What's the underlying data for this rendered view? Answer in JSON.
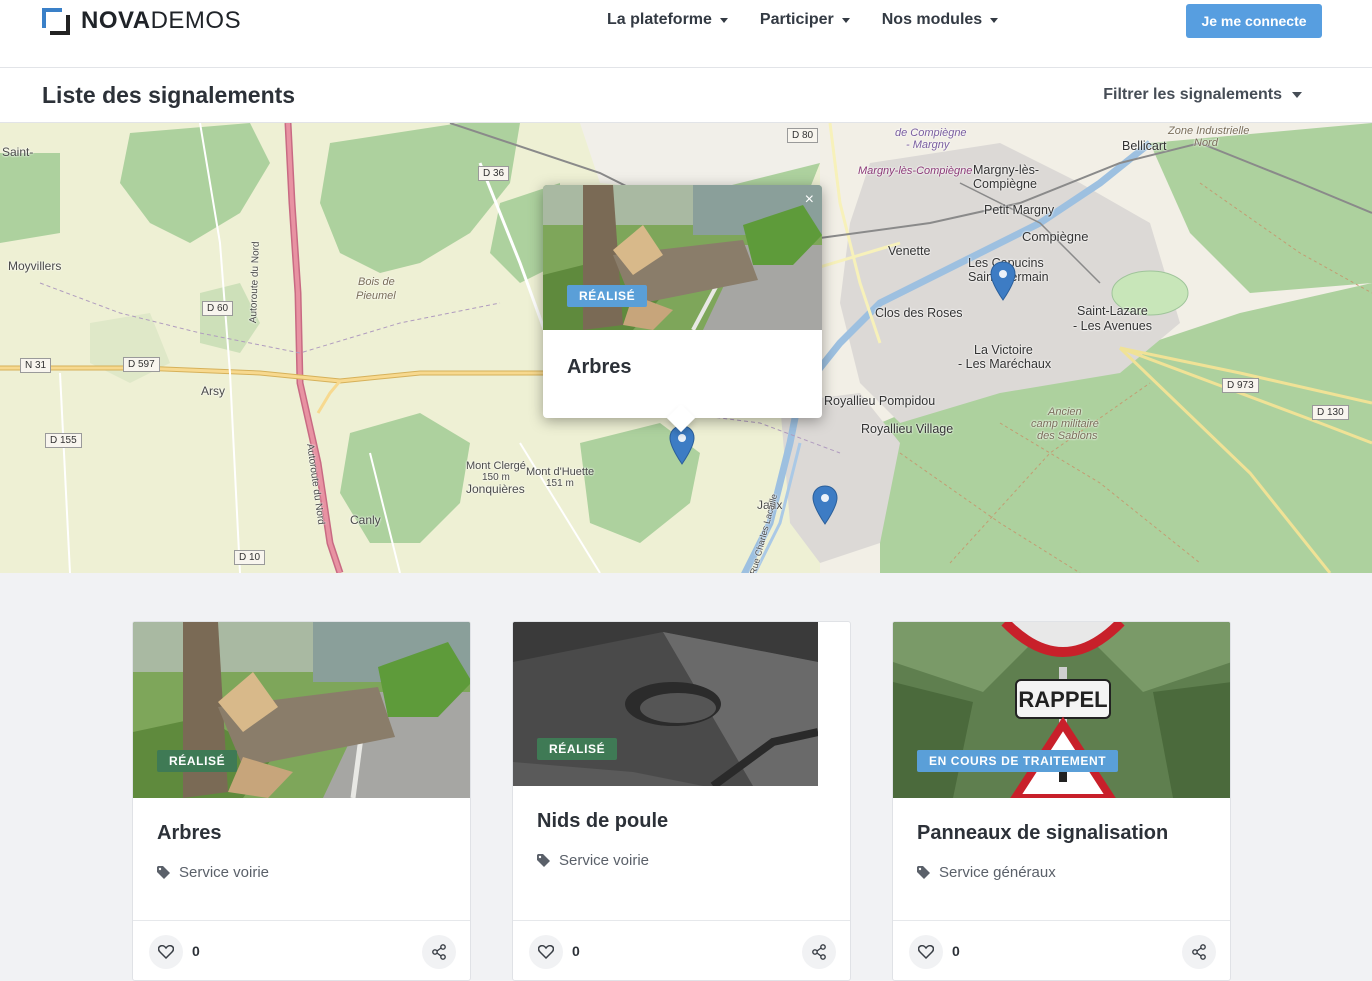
{
  "header": {
    "logo_bold": "NOVA",
    "logo_light": "DEMOS",
    "nav": [
      "La plateforme",
      "Participer",
      "Nos modules"
    ],
    "login_label": "Je me connecte"
  },
  "page": {
    "title": "Liste des signalements",
    "filter_label": "Filtrer les signalements"
  },
  "map": {
    "places": {
      "saint": "Saint-",
      "moyvillers": "Moyvillers",
      "bois": "Bois de",
      "bois2": "Pieumel",
      "arsy": "Arsy",
      "canly": "Canly",
      "mont_clerge": "Mont Clergé",
      "mont_clerge_alt": "150 m",
      "jonquieres": "Jonquières",
      "mont_huette": "Mont d'Huette",
      "mont_huette_alt": "151 m",
      "jaux": "Jaux",
      "venette": "Venette",
      "les_capucins": "Les Capucins",
      "saint_germain": "Saint-Germain",
      "compiegne": "Compiègne",
      "petit_margny": "Petit Margny",
      "margny": "Margny-lès-",
      "margny2": "Compiègne",
      "margny_station": "Margny-lès-Compiègne",
      "de_compiegne": "de Compiègne",
      "de_margny": "- Margny",
      "bellicart": "Bellicart",
      "zone": "Zone Industrielle",
      "zone2": "Nord",
      "clos": "Clos des Roses",
      "victoire": "La Victoire",
      "marechaux": "- Les Maréchaux",
      "saint_lazare": "Saint-Lazare",
      "avenues": "- Les Avenues",
      "pompidou": "Royallieu Pompidou",
      "royallieu_village": "Royallieu Village",
      "ancien": "Ancien",
      "camp": "camp militaire",
      "sablons": "des Sablons",
      "autoroute1": "Autoroute du Nord",
      "autoroute2": "Autoroute du Nord",
      "charles": "Rue Charles Lacaille"
    },
    "roads": [
      "D 80",
      "D 36",
      "D 60",
      "N 31",
      "D 597",
      "D 155",
      "D 10",
      "D 973",
      "D 130"
    ],
    "popup": {
      "badge": "RÉALISÉ",
      "title": "Arbres",
      "close": "×"
    }
  },
  "cards": [
    {
      "title": "Arbres",
      "category": "Service voirie",
      "status": "RÉALISÉ",
      "likes": "0",
      "status_color": "#3f7a55"
    },
    {
      "title": "Nids de poule",
      "category": "Service voirie",
      "status": "RÉALISÉ",
      "likes": "0",
      "status_color": "#3f7a55"
    },
    {
      "title": "Panneaux de signalisation",
      "category": "Service généraux",
      "status": "EN COURS DE TRAITEMENT",
      "likes": "0",
      "status_color": "#5a9fd8"
    }
  ],
  "sign_text": "RAPPEL",
  "colors": {
    "accent": "#579ee0",
    "done": "#3f7a55",
    "in_progress": "#5a9fd8",
    "marker": "#3d7cc4"
  }
}
